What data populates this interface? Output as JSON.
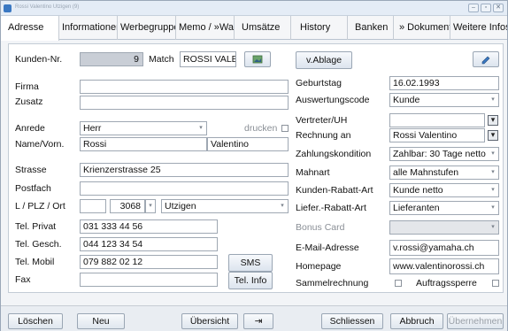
{
  "window": {
    "title": "Rossi Valentino  Utzigen  (9)"
  },
  "tabs": [
    "Adresse",
    "Informationen",
    "Werbegruppen",
    "Memo / »Wa",
    "Umsätze",
    "History",
    "Banken",
    "» Dokumente",
    "Weitere Infos"
  ],
  "left": {
    "kunden_nr_label": "Kunden-Nr.",
    "kunden_nr": "9",
    "match_label": "Match",
    "match": "ROSSI VALE",
    "firma_label": "Firma",
    "firma": "",
    "zusatz_label": "Zusatz",
    "zusatz": "",
    "anrede_label": "Anrede",
    "anrede": "Herr",
    "drucken_label": "drucken",
    "name_label": "Name/Vorn.",
    "name": "Rossi",
    "vorname": "Valentino",
    "strasse_label": "Strasse",
    "strasse": "Krienzerstrasse 25",
    "postfach_label": "Postfach",
    "postfach": "",
    "ort_label": "L / PLZ / Ort",
    "land": "",
    "plz": "3068",
    "ort": "Utzigen",
    "tel_privat_label": "Tel. Privat",
    "tel_privat": "031 333 44 56",
    "tel_gesch_label": "Tel. Gesch.",
    "tel_gesch": "044 123 34 54",
    "tel_mobil_label": "Tel. Mobil",
    "tel_mobil": "079 882 02 12",
    "fax_label": "Fax",
    "fax": "",
    "sms_button": "SMS",
    "telinfo_button": "Tel. Info"
  },
  "right": {
    "ablage_button": "v.Ablage",
    "geburtstag_label": "Geburtstag",
    "geburtstag": "16.02.1993",
    "auswertung_label": "Auswertungscode",
    "auswertung": "Kunde",
    "vertreter_label": "Vertreter/UH",
    "vertreter": "",
    "rechnung_label": "Rechnung an",
    "rechnung": "Rossi Valentino",
    "zahlung_label": "Zahlungskondition",
    "zahlung": "Zahlbar: 30 Tage netto",
    "mahnart_label": "Mahnart",
    "mahnart": "alle Mahnstufen",
    "rabatt_label": "Kunden-Rabatt-Art",
    "rabatt": "Kunde netto",
    "liefer_label": "Liefer.-Rabatt-Art",
    "liefer": "Lieferanten",
    "bonus_label": "Bonus Card",
    "bonus": "",
    "email_label": "E-Mail-Adresse",
    "email": "v.rossi@yamaha.ch",
    "homepage_label": "Homepage",
    "homepage": "www.valentinorossi.ch",
    "sammel_label": "Sammelrechnung",
    "auftrag_label": "Auftragssperre"
  },
  "footer": {
    "loeschen": "Löschen",
    "neu": "Neu",
    "uebersicht": "Übersicht",
    "pin": "⇥",
    "schliessen": "Schliessen",
    "abbruch": "Abbruch",
    "uebernehmen": "Übernehmen"
  },
  "colors": {
    "accent": "#3a78c2",
    "field_grey": "#c9ced6",
    "window_bg": "#f2f4f7"
  }
}
